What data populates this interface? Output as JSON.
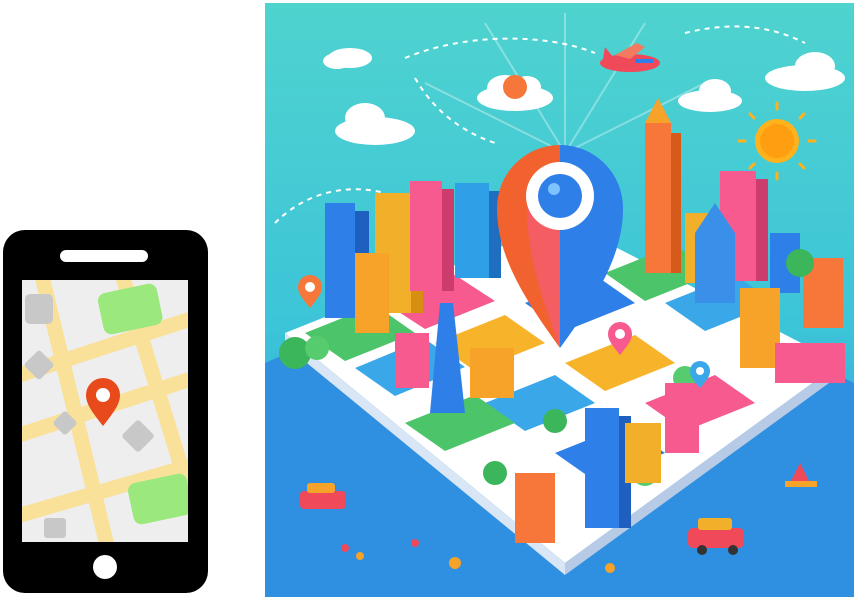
{
  "phone_illustration": {
    "icon": "smartphone-map-icon",
    "frame_color": "#000000",
    "screen_color": "#eeeeee",
    "road_color": "#f9e19a",
    "park_color": "#9be87c",
    "block_color": "#c8c8c8",
    "pin_color": "#e84a1c"
  },
  "city_illustration": {
    "icon": "city-map-location-pin-icon",
    "sky_color": "#3cc4d8",
    "ground_color": "#2f8fe0",
    "pin_left_color": "#f2622e",
    "pin_right_color": "#2f7fe8"
  }
}
